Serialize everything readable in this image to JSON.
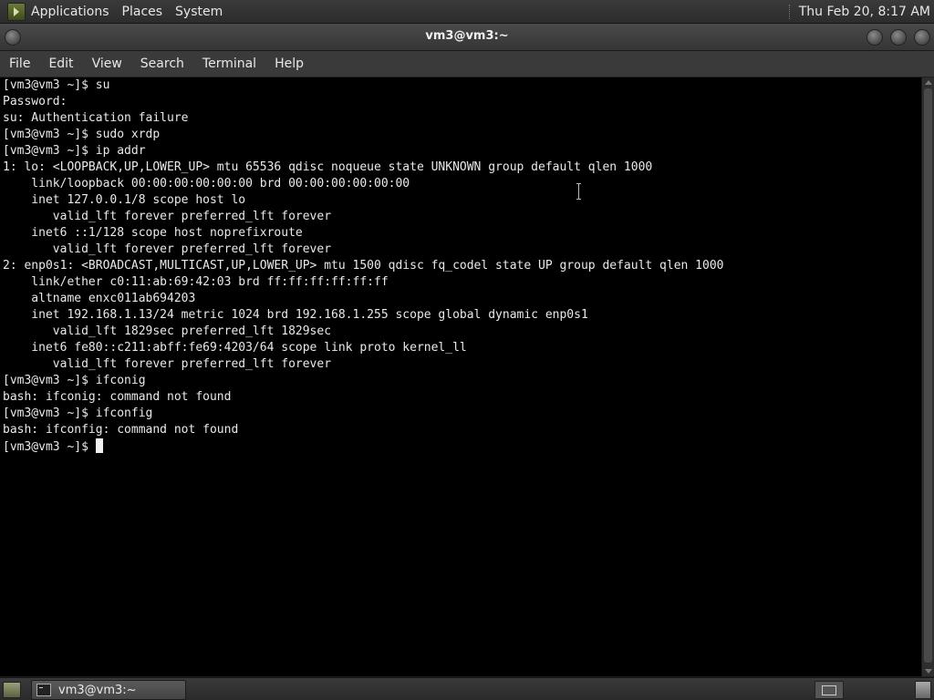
{
  "top_panel": {
    "menus": [
      "Applications",
      "Places",
      "System"
    ],
    "clock": "Thu Feb 20,  8:17 AM"
  },
  "window": {
    "title": "vm3@vm3:~"
  },
  "menubar": {
    "items": [
      "File",
      "Edit",
      "View",
      "Search",
      "Terminal",
      "Help"
    ]
  },
  "terminal": {
    "lines": [
      "[vm3@vm3 ~]$ su",
      "Password:",
      "su: Authentication failure",
      "[vm3@vm3 ~]$ sudo xrdp",
      "[vm3@vm3 ~]$ ip addr",
      "1: lo: <LOOPBACK,UP,LOWER_UP> mtu 65536 qdisc noqueue state UNKNOWN group default qlen 1000",
      "    link/loopback 00:00:00:00:00:00 brd 00:00:00:00:00:00",
      "    inet 127.0.0.1/8 scope host lo",
      "       valid_lft forever preferred_lft forever",
      "    inet6 ::1/128 scope host noprefixroute",
      "       valid_lft forever preferred_lft forever",
      "2: enp0s1: <BROADCAST,MULTICAST,UP,LOWER_UP> mtu 1500 qdisc fq_codel state UP group default qlen 1000",
      "    link/ether c0:11:ab:69:42:03 brd ff:ff:ff:ff:ff:ff",
      "    altname enxc011ab694203",
      "    inet 192.168.1.13/24 metric 1024 brd 192.168.1.255 scope global dynamic enp0s1",
      "       valid_lft 1829sec preferred_lft 1829sec",
      "    inet6 fe80::c211:abff:fe69:4203/64 scope link proto kernel_ll",
      "       valid_lft forever preferred_lft forever",
      "[vm3@vm3 ~]$ ifconig",
      "bash: ifconig: command not found",
      "[vm3@vm3 ~]$ ifconfig",
      "bash: ifconfig: command not found"
    ],
    "prompt": "[vm3@vm3 ~]$ "
  },
  "taskbar": {
    "task_label": "vm3@vm3:~"
  }
}
